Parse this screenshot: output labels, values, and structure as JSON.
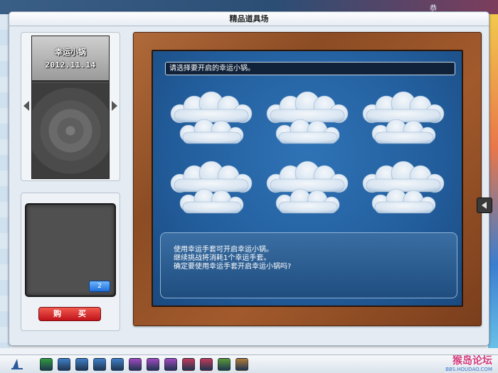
{
  "window": {
    "title": "精品道具场",
    "topright_text": "恭"
  },
  "preview": {
    "item_name": "幸运小锅",
    "date": "2012.11.14"
  },
  "slot": {
    "count": "2",
    "buy_label": "购 买"
  },
  "board": {
    "prompt": "请选择要开启的幸运小锅。",
    "clouds": [
      {
        "label": ""
      },
      {
        "label": ""
      },
      {
        "label": ""
      },
      {
        "label": ""
      },
      {
        "label": ""
      },
      {
        "label": ""
      }
    ],
    "message_lines": [
      "使用幸运手套可开启幸运小锅。",
      "继续挑战将消耗1个幸运手套。",
      "确定要使用幸运手套开启幸运小锅吗?"
    ]
  },
  "toolbar": {
    "icons": [
      {
        "name": "back-icon",
        "color": "#2e9b3e"
      },
      {
        "name": "shop-icon",
        "color": "#3f7fc8"
      },
      {
        "name": "home-icon",
        "color": "#3f7fc8"
      },
      {
        "name": "tool-icon",
        "color": "#3f7fc8"
      },
      {
        "name": "chat-icon",
        "color": "#3f7fc8"
      },
      {
        "name": "gift-icon",
        "color": "#a04ac0"
      },
      {
        "name": "party-icon",
        "color": "#a04ac0"
      },
      {
        "name": "pet-icon",
        "color": "#a04ac0"
      },
      {
        "name": "book-icon",
        "color": "#c03a5a"
      },
      {
        "name": "friends-icon",
        "color": "#c03a5a"
      },
      {
        "name": "mail-icon",
        "color": "#5a9a3a"
      },
      {
        "name": "photo-icon",
        "color": "#b07a3a"
      }
    ],
    "watermark": "猴岛论坛",
    "watermark_sub": "BBS.HOUDAO.COM"
  },
  "colors": {
    "board_blue": "#235f9e",
    "buy_red": "#c0131b",
    "wood": "#8c4c24"
  }
}
